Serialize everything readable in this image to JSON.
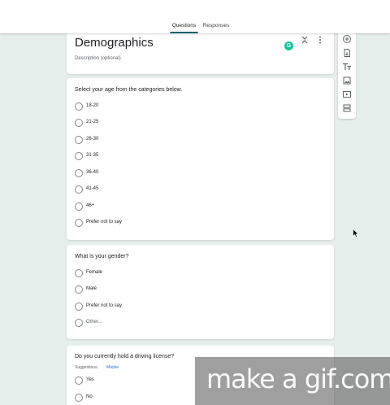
{
  "tabs": {
    "questions": "Questions",
    "responses": "Responses"
  },
  "form": {
    "title": "Demographics",
    "description_placeholder": "Description (optional)"
  },
  "questions": [
    {
      "title": "Select your age from the categories below.",
      "options": [
        "18-20",
        "21-25",
        "26-30",
        "31-35",
        "36-40",
        "41-45",
        "46+",
        "Prefer not to say"
      ]
    },
    {
      "title": "What is your gender?",
      "options": [
        "Female",
        "Male",
        "Prefer not to say",
        "Other..."
      ]
    },
    {
      "title": "Do you currently hold a driving license?",
      "suggestions_label": "Suggestions:",
      "suggestion": "Maybe",
      "options": [
        "Yes",
        "No"
      ]
    }
  ],
  "grammarly_letter": "G",
  "watermark": "make a gif.com",
  "colors": {
    "accent": "#10616e",
    "background": "#e6eeec",
    "grammarly": "#15c39a",
    "link": "#1a73e8"
  },
  "icons": [
    "add-question-icon",
    "import-questions-icon",
    "add-title-icon",
    "add-image-icon",
    "add-video-icon",
    "add-section-icon",
    "collapse-icon",
    "more-vert-icon",
    "grammarly-icon",
    "mouse-cursor-icon"
  ]
}
